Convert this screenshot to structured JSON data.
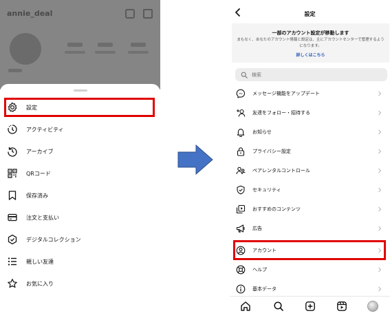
{
  "left_phone": {
    "username": "annie_deal",
    "menu": [
      {
        "label": "設定",
        "icon": "gear-icon"
      },
      {
        "label": "アクティビティ",
        "icon": "activity-icon"
      },
      {
        "label": "アーカイブ",
        "icon": "archive-icon"
      },
      {
        "label": "QRコード",
        "icon": "qr-code-icon"
      },
      {
        "label": "保存済み",
        "icon": "bookmark-icon"
      },
      {
        "label": "注文と支払い",
        "icon": "credit-card-icon"
      },
      {
        "label": "デジタルコレクション",
        "icon": "verified-badge-icon"
      },
      {
        "label": "親しい友達",
        "icon": "close-friends-list-icon"
      },
      {
        "label": "お気に入り",
        "icon": "star-icon"
      }
    ]
  },
  "right_phone": {
    "title": "設定",
    "notice": {
      "title": "一部のアカウント設定が移動します",
      "body": "まもなく、あなたのアカウント情報と設定は、主にアカウントセンターで管理するようになります。",
      "link": "詳しくはこちら"
    },
    "search": {
      "placeholder": "検索"
    },
    "items": [
      {
        "label": "メッセージ機能をアップデート",
        "icon": "messenger-icon"
      },
      {
        "label": "友達をフォロー・招待する",
        "icon": "add-person-icon"
      },
      {
        "label": "お知らせ",
        "icon": "bell-icon"
      },
      {
        "label": "プライバシー設定",
        "icon": "lock-icon"
      },
      {
        "label": "ペアレンタルコントロール",
        "icon": "supervision-icon"
      },
      {
        "label": "セキュリティ",
        "icon": "shield-check-icon"
      },
      {
        "label": "おすすめのコンテンツ",
        "icon": "content-icon"
      },
      {
        "label": "広告",
        "icon": "megaphone-icon"
      },
      {
        "label": "アカウント",
        "icon": "account-circle-icon"
      },
      {
        "label": "ヘルプ",
        "icon": "lifebuoy-icon"
      },
      {
        "label": "基本データ",
        "icon": "info-icon"
      }
    ],
    "bottom_nav": [
      "home-icon",
      "search-icon",
      "create-post-icon",
      "reels-icon",
      "profile-avatar"
    ]
  },
  "colors": {
    "highlight": "#e00000",
    "arrow": "#4472c4",
    "link": "#2a5bb8"
  }
}
